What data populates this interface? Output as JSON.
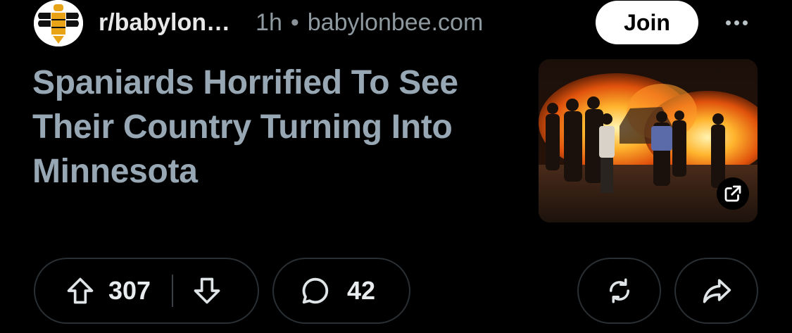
{
  "post": {
    "subreddit": "r/babylon…",
    "time": "1h",
    "separator": "•",
    "domain": "babylonbee.com",
    "join_label": "Join",
    "title": "Spaniards Horrified To See Their Country Turning Into Minnesota"
  },
  "actions": {
    "upvotes": "307",
    "comments": "42"
  },
  "colors": {
    "background": "#000000",
    "title": "#97a7b4",
    "meta": "#8f99a0",
    "pill_border": "#2a2f33",
    "join_bg": "#ffffff"
  },
  "icons": {
    "avatar": "bee-logo-icon",
    "more": "more-options-icon",
    "external": "external-link-icon",
    "upvote": "arrow-up-icon",
    "downvote": "arrow-down-icon",
    "comment": "comment-bubble-icon",
    "repost": "repost-icon",
    "share": "share-arrow-icon"
  }
}
